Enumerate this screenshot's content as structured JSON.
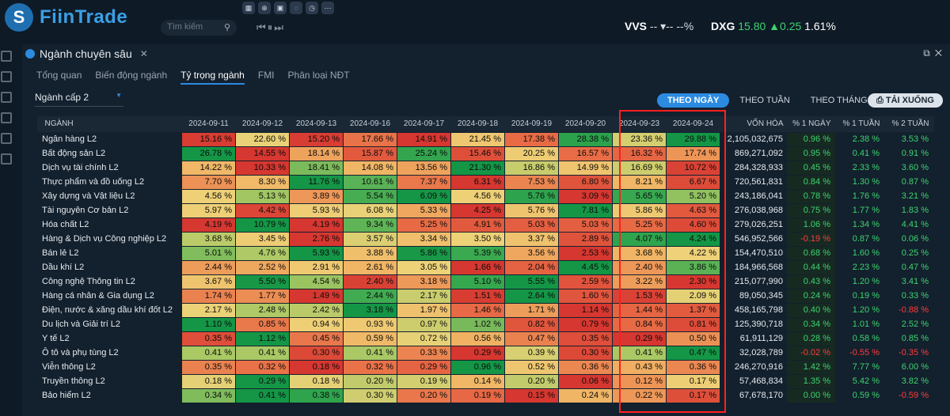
{
  "header": {
    "logo": "FiinTrade",
    "logo_mark": "S",
    "search_placeholder": "Tìm kiếm",
    "ticker1": {
      "symbol": "VVS",
      "value": "-- ▾--",
      "pct": "--%"
    },
    "ticker2": {
      "symbol": "DXG",
      "price": "15.80",
      "change": "▲0.25",
      "pct": "1.61%"
    }
  },
  "panel": {
    "title": "Ngành chuyên sâu",
    "tabs": [
      "Tổng quan",
      "Biến động ngành",
      "Tỷ trọng ngành",
      "FMI",
      "Phân loại NĐT"
    ],
    "active_tab": 2,
    "level": "Ngành cấp 2",
    "seg": [
      "THEO NGÀY",
      "THEO TUẦN",
      "THEO THÁNG"
    ],
    "download": "TẢI XUỐNG"
  },
  "table": {
    "headers": [
      "NGÀNH",
      "2024-09-11",
      "2024-09-12",
      "2024-09-13",
      "2024-09-16",
      "2024-09-17",
      "2024-09-18",
      "2024-09-19",
      "2024-09-20",
      "2024-09-23",
      "2024-09-24",
      "VỐN HÓA",
      "% 1 NGÀY",
      "% 1 TUẦN",
      "% 2 TUẦN"
    ],
    "rows": [
      [
        "Ngân hàng L2",
        "15.16 %",
        "22.60 %",
        "15.20 %",
        "17.66 %",
        "14.91 %",
        "21.45 %",
        "17.38 %",
        "28.38 %",
        "23.36 %",
        "29.88 %",
        "2,105,032,675",
        "0.96 %",
        "2.38 %",
        "3.53 %"
      ],
      [
        "Bất động sản L2",
        "26.78 %",
        "14.55 %",
        "18.14 %",
        "15.87 %",
        "25.24 %",
        "15.46 %",
        "20.25 %",
        "16.57 %",
        "16.32 %",
        "17.74 %",
        "869,271,092",
        "0.95 %",
        "0.41 %",
        "0.91 %"
      ],
      [
        "Dịch vụ tài chính L2",
        "14.22 %",
        "10.33 %",
        "18.41 %",
        "14.08 %",
        "13.56 %",
        "21.30 %",
        "16.86 %",
        "14.99 %",
        "16.69 %",
        "10.72 %",
        "284,328,933",
        "0.45 %",
        "2.33 %",
        "3.60 %"
      ],
      [
        "Thực phẩm và đồ uống L2",
        "7.70 %",
        "8.30 %",
        "11.76 %",
        "10.61 %",
        "7.37 %",
        "6.31 %",
        "7.53 %",
        "6.80 %",
        "8.21 %",
        "6.67 %",
        "720,561,831",
        "0.84 %",
        "1.30 %",
        "0.87 %"
      ],
      [
        "Xây dựng và Vật liệu L2",
        "4.56 %",
        "5.13 %",
        "3.89 %",
        "5.54 %",
        "6.09 %",
        "4.56 %",
        "5.76 %",
        "3.09 %",
        "5.65 %",
        "5.20 %",
        "243,186,041",
        "0.78 %",
        "1.76 %",
        "3.21 %"
      ],
      [
        "Tài nguyên Cơ bản L2",
        "5.97 %",
        "4.42 %",
        "5.93 %",
        "6.08 %",
        "5.33 %",
        "4.25 %",
        "5.76 %",
        "7.81 %",
        "5.86 %",
        "4.63 %",
        "276,038,968",
        "0.75 %",
        "1.77 %",
        "1.83 %"
      ],
      [
        "Hóa chất L2",
        "4.19 %",
        "10.79 %",
        "4.19 %",
        "9.34 %",
        "5.25 %",
        "4.91 %",
        "5.03 %",
        "5.03 %",
        "5.25 %",
        "4.60 %",
        "279,026,251",
        "1.06 %",
        "1.34 %",
        "4.41 %"
      ],
      [
        "Hàng & Dịch vụ Công nghiệp L2",
        "3.68 %",
        "3.45 %",
        "2.76 %",
        "3.57 %",
        "3.34 %",
        "3.50 %",
        "3.37 %",
        "2.89 %",
        "4.07 %",
        "4.24 %",
        "546,952,566",
        "-0.19 %",
        "0.87 %",
        "0.06 %"
      ],
      [
        "Bán lẻ L2",
        "5.01 %",
        "4.76 %",
        "5.93 %",
        "3.88 %",
        "5.86 %",
        "5.39 %",
        "3.56 %",
        "2.53 %",
        "3.68 %",
        "4.22 %",
        "154,470,510",
        "0.68 %",
        "1.60 %",
        "0.25 %"
      ],
      [
        "Dầu khí L2",
        "2.44 %",
        "2.52 %",
        "2.91 %",
        "2.61 %",
        "3.05 %",
        "1.66 %",
        "2.04 %",
        "4.45 %",
        "2.40 %",
        "3.86 %",
        "184,966,568",
        "0.44 %",
        "2.23 %",
        "0.47 %"
      ],
      [
        "Công nghệ Thông tin L2",
        "3.67 %",
        "5.50 %",
        "4.54 %",
        "2.40 %",
        "3.18 %",
        "5.10 %",
        "5.55 %",
        "2.59 %",
        "3.22 %",
        "2.30 %",
        "215,077,990",
        "0.43 %",
        "1.20 %",
        "3.41 %"
      ],
      [
        "Hàng cá nhân & Gia dụng L2",
        "1.74 %",
        "1.77 %",
        "1.49 %",
        "2.44 %",
        "2.17 %",
        "1.51 %",
        "2.64 %",
        "1.60 %",
        "1.53 %",
        "2.09 %",
        "89,050,345",
        "0.24 %",
        "0.19 %",
        "0.33 %"
      ],
      [
        "Điện, nước & xăng dầu khí đốt L2",
        "2.17 %",
        "2.48 %",
        "2.42 %",
        "3.18 %",
        "1.97 %",
        "1.46 %",
        "1.71 %",
        "1.14 %",
        "1.44 %",
        "1.37 %",
        "458,165,798",
        "0.40 %",
        "1.20 %",
        "-0.88 %"
      ],
      [
        "Du lịch và Giải trí L2",
        "1.10 %",
        "0.85 %",
        "0.94 %",
        "0.93 %",
        "0.97 %",
        "1.02 %",
        "0.82 %",
        "0.79 %",
        "0.84 %",
        "0.81 %",
        "125,390,718",
        "0.34 %",
        "1.01 %",
        "2.52 %"
      ],
      [
        "Y tế L2",
        "0.35 %",
        "1.12 %",
        "0.45 %",
        "0.59 %",
        "0.72 %",
        "0.56 %",
        "0.47 %",
        "0.35 %",
        "0.29 %",
        "0.50 %",
        "61,911,129",
        "0.28 %",
        "0.58 %",
        "0.85 %"
      ],
      [
        "Ô tô và phụ tùng L2",
        "0.41 %",
        "0.41 %",
        "0.30 %",
        "0.41 %",
        "0.33 %",
        "0.29 %",
        "0.39 %",
        "0.30 %",
        "0.41 %",
        "0.47 %",
        "32,028,789",
        "-0.02 %",
        "-0.55 %",
        "-0.35 %"
      ],
      [
        "Viễn thông L2",
        "0.35 %",
        "0.32 %",
        "0.18 %",
        "0.32 %",
        "0.29 %",
        "0.96 %",
        "0.52 %",
        "0.36 %",
        "0.43 %",
        "0.36 %",
        "246,270,916",
        "1.42 %",
        "7.77 %",
        "6.00 %"
      ],
      [
        "Truyền thông L2",
        "0.18 %",
        "0.29 %",
        "0.18 %",
        "0.20 %",
        "0.19 %",
        "0.14 %",
        "0.20 %",
        "0.06 %",
        "0.12 %",
        "0.17 %",
        "57,468,834",
        "1.35 %",
        "5.42 %",
        "3.82 %"
      ],
      [
        "Bảo hiểm L2",
        "0.34 %",
        "0.41 %",
        "0.38 %",
        "0.30 %",
        "0.20 %",
        "0.19 %",
        "0.15 %",
        "0.24 %",
        "0.22 %",
        "0.17 %",
        "67,678,170",
        "0.00 %",
        "0.59 %",
        "-0.59 %"
      ]
    ]
  },
  "colors": {
    "accent": "#2c8be0",
    "highlight": "#ff2020",
    "positive": "#3dd46f",
    "negative": "#ff3b3b"
  }
}
